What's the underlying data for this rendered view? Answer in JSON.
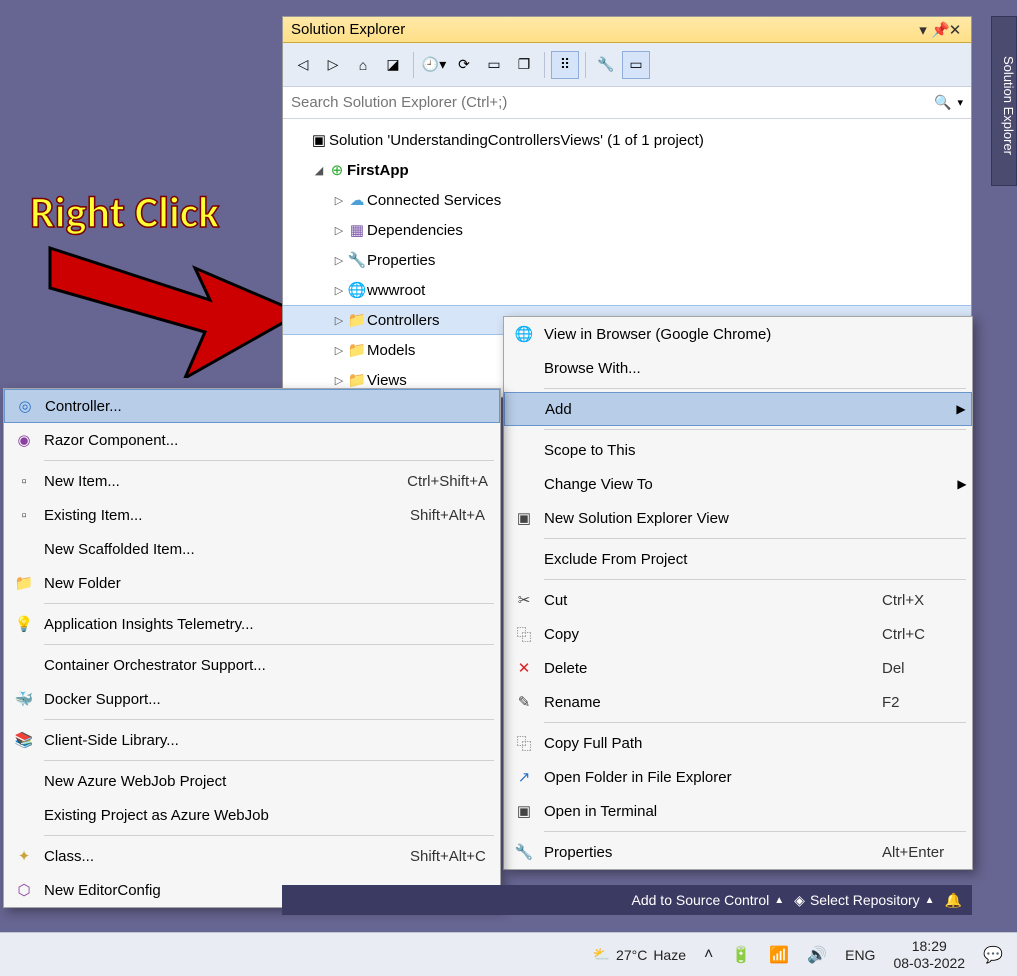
{
  "annotation": "Right Click",
  "panel": {
    "title": "Solution Explorer",
    "search_placeholder": "Search Solution Explorer (Ctrl+;)",
    "solution_line": "Solution 'UnderstandingControllersViews' (1 of 1 project)",
    "project": "FirstApp",
    "nodes": {
      "connected_services": "Connected Services",
      "dependencies": "Dependencies",
      "properties": "Properties",
      "wwwroot": "wwwroot",
      "controllers": "Controllers",
      "models": "Models",
      "views": "Views"
    }
  },
  "vtab": "Solution Explorer",
  "context": {
    "view_in_browser": "View in Browser (Google Chrome)",
    "browse_with": "Browse With...",
    "add": "Add",
    "scope": "Scope to This",
    "change_view": "Change View To",
    "new_sol_view": "New Solution Explorer View",
    "exclude": "Exclude From Project",
    "cut": "Cut",
    "cut_sc": "Ctrl+X",
    "copy": "Copy",
    "copy_sc": "Ctrl+C",
    "delete": "Delete",
    "delete_sc": "Del",
    "rename": "Rename",
    "rename_sc": "F2",
    "copy_path": "Copy Full Path",
    "open_folder": "Open Folder in File Explorer",
    "open_terminal": "Open in Terminal",
    "properties": "Properties",
    "properties_sc": "Alt+Enter"
  },
  "submenu": {
    "controller": "Controller...",
    "razor": "Razor Component...",
    "new_item": "New Item...",
    "new_item_sc": "Ctrl+Shift+A",
    "existing_item": "Existing Item...",
    "existing_item_sc": "Shift+Alt+A",
    "scaffolded": "New Scaffolded Item...",
    "new_folder": "New Folder",
    "app_insights": "Application Insights Telemetry...",
    "container": "Container Orchestrator Support...",
    "docker": "Docker Support...",
    "client_lib": "Client-Side Library...",
    "webjob": "New Azure WebJob Project",
    "webjob_existing": "Existing Project as Azure WebJob",
    "class": "Class...",
    "class_sc": "Shift+Alt+C",
    "editorconfig": "New EditorConfig"
  },
  "status": {
    "add_source": "Add to Source Control",
    "select_repo": "Select Repository"
  },
  "taskbar": {
    "temp": "27°C",
    "weather": "Haze",
    "lang": "ENG",
    "time": "18:29",
    "date": "08-03-2022"
  }
}
